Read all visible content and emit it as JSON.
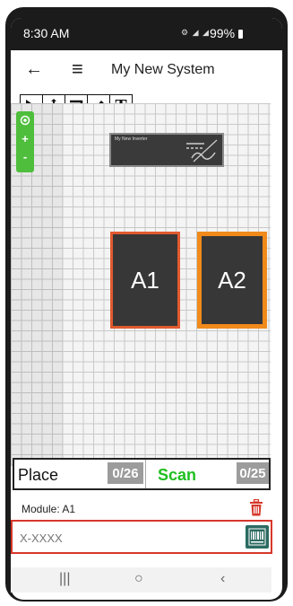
{
  "status_bar": {
    "time": "8:30 AM",
    "battery": "99%"
  },
  "app_bar": {
    "title": "My New System"
  },
  "toolbar": {
    "text_tool_label": "T"
  },
  "zoom": {
    "plus": "+",
    "minus": "-"
  },
  "canvas": {
    "inverter_label": "My New Inverter",
    "modules": [
      {
        "label": "A1",
        "border_color": "#e05a2f"
      },
      {
        "label": "A2",
        "border_color": "#f08a1b"
      }
    ]
  },
  "counters": {
    "place_label": "Place",
    "place_count": "0/26",
    "scan_label": "Scan",
    "scan_count": "0/25"
  },
  "module_info": {
    "label": "Module: A1"
  },
  "serial_input": {
    "placeholder": "X-XXXX",
    "value": ""
  },
  "colors": {
    "accent_green": "#4fbe3c",
    "scan_green": "#1fbf1f",
    "selected_border": "#d6372a",
    "barcode_teal": "#2c6b62",
    "trash_red": "#d6372a"
  },
  "icons": {
    "back": "arrow-left-icon",
    "menu": "hamburger-icon",
    "select": "cursor-icon",
    "move": "move-icon",
    "rotate": "rotate-icon",
    "draw": "pencil-icon",
    "text": "text-icon",
    "trash": "trash-icon",
    "barcode": "barcode-icon",
    "recenter": "target-icon"
  }
}
